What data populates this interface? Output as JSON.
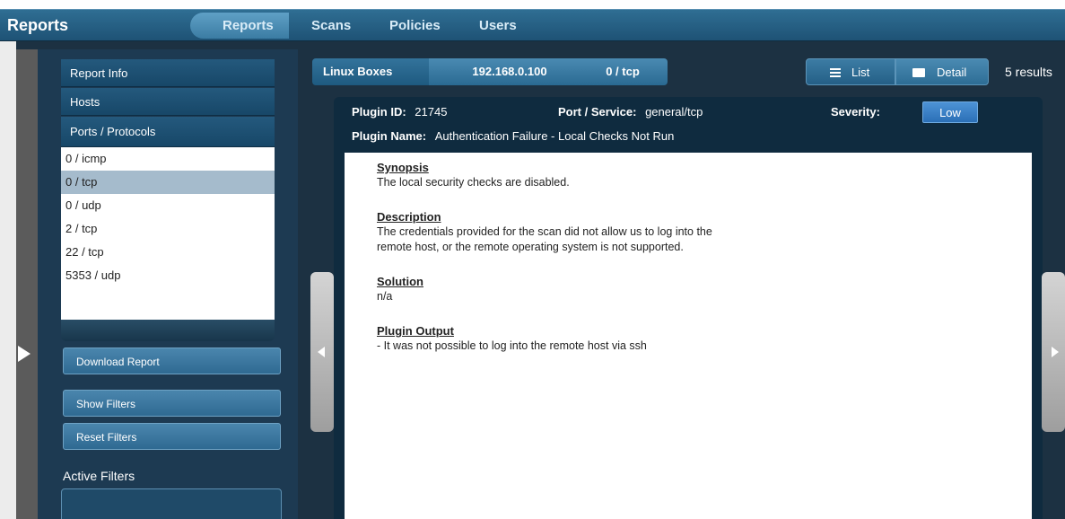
{
  "app": {
    "title": "Reports"
  },
  "nav": {
    "items": [
      "Reports",
      "Scans",
      "Policies",
      "Users"
    ]
  },
  "sidebar": {
    "items": [
      "Report Info",
      "Hosts",
      "Ports / Protocols"
    ],
    "ports": [
      "0 / icmp",
      "0 / tcp",
      "0 / udp",
      "2 / tcp",
      "22 / tcp",
      "5353 / udp"
    ],
    "selected_port": "0 / tcp",
    "download_label": "Download Report",
    "show_filters_label": "Show Filters",
    "reset_filters_label": "Reset Filters",
    "active_filters_label": "Active Filters"
  },
  "breadcrumb": [
    "Linux Boxes",
    "192.168.0.100",
    "0 / tcp"
  ],
  "view": {
    "list_label": "List",
    "detail_label": "Detail",
    "results": "5 results"
  },
  "plugin": {
    "id_label": "Plugin ID:",
    "id": "21745",
    "port_label": "Port / Service:",
    "port": "general/tcp",
    "severity_label": "Severity:",
    "severity": "Low",
    "name_label": "Plugin Name:",
    "name": "Authentication Failure - Local Checks Not Run"
  },
  "detail": {
    "synopsis_title": "Synopsis",
    "synopsis": "The local security checks are disabled.",
    "description_title": "Description",
    "description_line1": "The credentials provided for the scan did not allow us to log into the",
    "description_line2": "remote host, or the remote operating system is not supported.",
    "solution_title": "Solution",
    "solution": "n/a",
    "output_title": "Plugin Output",
    "output": "- It was not possible to log into the remote host via ssh"
  },
  "colors": {
    "accent": "#2f6e93",
    "severity_low": "#3a80c6",
    "panel": "#1c3142"
  }
}
